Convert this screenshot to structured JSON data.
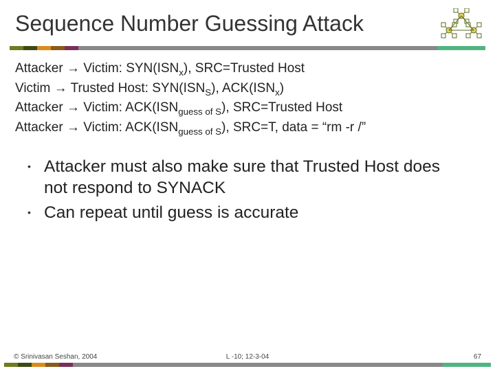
{
  "title": "Sequence Number Guessing Attack",
  "protocol": {
    "l1_pre": "Attacker ",
    "l1_post": " Victim: SYN(ISN",
    "l1_sub": "x",
    "l1_end": "), SRC=Trusted Host",
    "l2_pre": "Victim ",
    "l2_post": " Trusted Host: SYN(ISN",
    "l2_sub1": "S",
    "l2_mid": "), ACK(ISN",
    "l2_sub2": "x",
    "l2_end": ")",
    "l3_pre": "Attacker ",
    "l3_post": " Victim: ACK(ISN",
    "l3_sub": "guess of S",
    "l3_end": "), SRC=Trusted Host",
    "l4_pre": "Attacker ",
    "l4_post": " Victim: ACK(ISN",
    "l4_sub": "guess of S",
    "l4_end": "), SRC=T, data = “rm -r /”"
  },
  "arrow": "→",
  "bullets": {
    "b1": "Attacker must also make sure that Trusted Host does not respond to SYNACK",
    "b2": "Can repeat until guess is accurate"
  },
  "footer": {
    "copyright": "© Srinivasan Seshan, 2004",
    "center": "L -10; 12-3-04",
    "page": "67"
  },
  "colors": {
    "olive": "#6b7d1f",
    "dkolive": "#3e4a12",
    "orange": "#d98c1a",
    "brown": "#8a5a1a",
    "plum": "#7a2f5a",
    "gray": "#888888",
    "aqua": "#4fb580"
  }
}
